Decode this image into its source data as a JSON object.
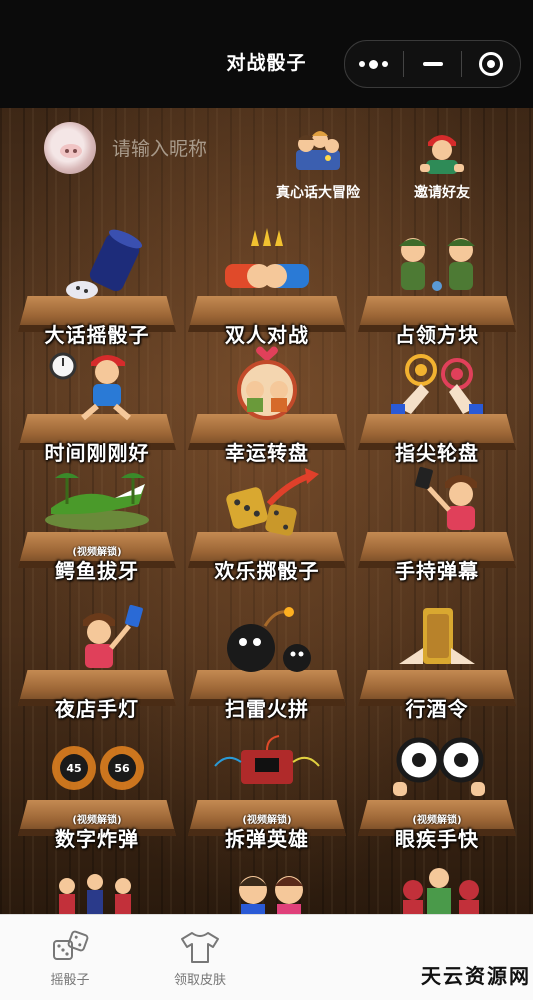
{
  "window": {
    "title": "对战骰子"
  },
  "profile": {
    "nickname_placeholder": "请输入昵称"
  },
  "top_links": [
    {
      "label": "真心话大冒险",
      "icon": "truth-or-dare-icon"
    },
    {
      "label": "邀请好友",
      "icon": "invite-friends-icon"
    }
  ],
  "games": [
    {
      "label": "大话摇骰子",
      "icon": "dice-cup-icon",
      "locked": false
    },
    {
      "label": "双人对战",
      "icon": "fist-bump-icon",
      "locked": false
    },
    {
      "label": "占领方块",
      "icon": "soldiers-icon",
      "locked": false
    },
    {
      "label": "时间刚刚好",
      "icon": "alarm-clock-icon",
      "locked": false
    },
    {
      "label": "幸运转盘",
      "icon": "lucky-wheel-icon",
      "locked": false
    },
    {
      "label": "指尖轮盘",
      "icon": "fingertip-icon",
      "locked": false
    },
    {
      "label": "鳄鱼拔牙",
      "icon": "crocodile-icon",
      "locked": true,
      "lock_label": "(视频解锁)"
    },
    {
      "label": "欢乐掷骰子",
      "icon": "golden-dice-icon",
      "locked": false
    },
    {
      "label": "手持弹幕",
      "icon": "handheld-marquee-icon",
      "locked": false
    },
    {
      "label": "夜店手灯",
      "icon": "club-light-icon",
      "locked": false
    },
    {
      "label": "扫雷火拼",
      "icon": "bomb-icon",
      "locked": false
    },
    {
      "label": "行酒令",
      "icon": "drinking-icon",
      "locked": false
    },
    {
      "label": "数字炸弹",
      "icon": "number-bomb-icon",
      "locked": true,
      "lock_label": "(视频解锁)",
      "numbers": [
        "45",
        "56"
      ]
    },
    {
      "label": "拆弹英雄",
      "icon": "defuse-bomb-icon",
      "locked": true,
      "lock_label": "(视频解锁)"
    },
    {
      "label": "眼疾手快",
      "icon": "eyes-icon",
      "locked": true,
      "lock_label": "(视频解锁)"
    },
    {
      "label": "",
      "icon": "dancers-icon",
      "locked": false
    },
    {
      "label": "",
      "icon": "couple-icon",
      "locked": false
    },
    {
      "label": "",
      "icon": "fighters-icon",
      "locked": false
    }
  ],
  "tabbar": {
    "tabs": [
      {
        "label": "摇骰子",
        "icon": "dice-icon"
      },
      {
        "label": "领取皮肤",
        "icon": "tshirt-icon"
      }
    ]
  },
  "watermark": "天云资源网"
}
